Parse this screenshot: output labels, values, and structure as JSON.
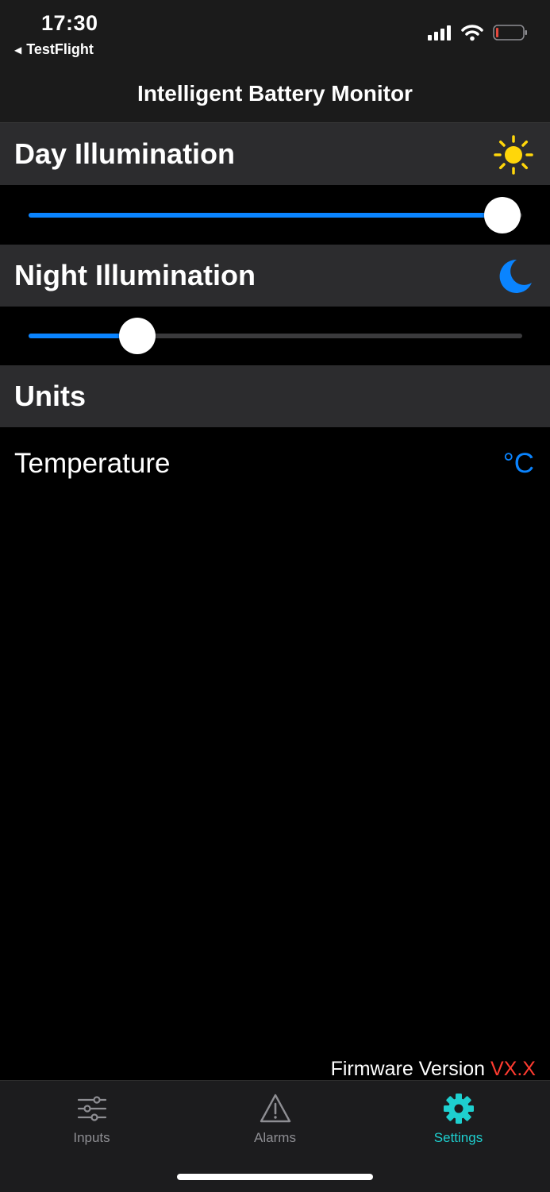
{
  "status_bar": {
    "time": "17:30",
    "back_app": "TestFlight",
    "icons": [
      "cellular-signal-icon",
      "wifi-icon",
      "battery-icon"
    ],
    "battery_color": "#e5483d"
  },
  "nav": {
    "title": "Intelligent Battery Monitor"
  },
  "sections": {
    "day": {
      "title": "Day Illumination",
      "icon": "sun-icon",
      "icon_color": "#ffd60a",
      "slider_value": 0.96
    },
    "night": {
      "title": "Night Illumination",
      "icon": "moon-icon",
      "icon_color": "#0a84ff",
      "slider_value": 0.22
    },
    "units": {
      "title": "Units"
    }
  },
  "units": {
    "temperature_label": "Temperature",
    "temperature_value": "°C"
  },
  "footer": {
    "firmware_label": "Firmware Version",
    "firmware_value": "VX.X"
  },
  "tabs": [
    {
      "label": "Inputs",
      "icon": "sliders-icon",
      "active": false
    },
    {
      "label": "Alarms",
      "icon": "warning-icon",
      "active": false
    },
    {
      "label": "Settings",
      "icon": "gear-icon",
      "active": true
    }
  ],
  "colors": {
    "accent": "#0a84ff",
    "active_tab": "#1ecfcf",
    "firmware_value": "#ff3b30"
  }
}
